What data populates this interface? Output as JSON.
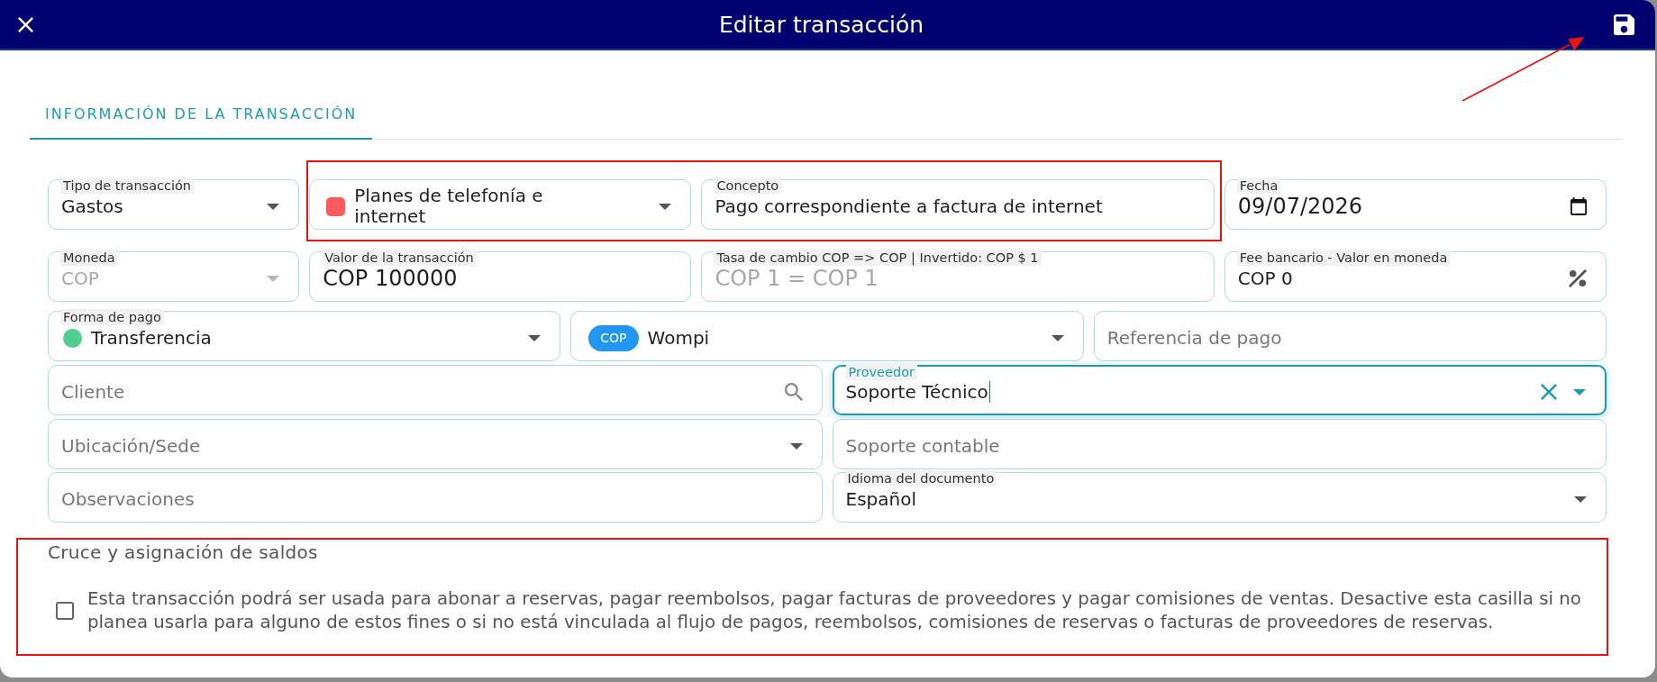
{
  "dialog": {
    "title": "Editar transacción"
  },
  "tabs": [
    {
      "label": "INFORMACIÓN DE LA TRANSACCIÓN",
      "selected": true
    }
  ],
  "form": {
    "rows": [
      [
        {
          "kind": "select",
          "label": "Tipo de transacción",
          "value": "Gastos",
          "disabled": false,
          "focused": false
        },
        {
          "kind": "select",
          "value": "Planes de telefonía e internet",
          "swatch": {
            "kind": "square",
            "color": "#ff5a5f"
          },
          "disabled": false,
          "focused": false
        },
        {
          "kind": "text",
          "label": "Concepto",
          "value": "Pago correspondiente a factura de internet",
          "disabled": false,
          "focused": false
        },
        {
          "kind": "date",
          "label": "Fecha",
          "value": "09/07/2026",
          "disabled": false,
          "focused": false
        }
      ],
      [
        {
          "kind": "select",
          "label": "Moneda",
          "value": "COP",
          "disabled": true,
          "focused": false
        },
        {
          "kind": "amount",
          "label": "Valor de la transacción",
          "value": "COP 100000",
          "disabled": false,
          "focused": false
        },
        {
          "kind": "amount",
          "label": "Tasa de cambio COP => COP | Invertido: COP $ 1",
          "value": "COP 1 = COP 1",
          "disabled": true,
          "focused": false
        },
        {
          "kind": "percent",
          "label": "Fee bancario - Valor en moneda",
          "value": "COP 0",
          "disabled": false,
          "focused": false
        }
      ],
      [
        {
          "kind": "select",
          "label": "Forma de pago",
          "value": "Transferencia",
          "swatch": {
            "kind": "dot",
            "color": "#4fcf8d"
          },
          "disabled": false,
          "focused": false
        },
        {
          "kind": "select",
          "chip": "COP",
          "value": "Wompi",
          "disabled": false,
          "focused": false
        },
        {
          "kind": "text",
          "placeholder": "Referencia de pago",
          "disabled": false,
          "focused": false
        }
      ],
      [
        {
          "kind": "search",
          "placeholder": "Cliente",
          "disabled": false,
          "focused": false
        },
        {
          "kind": "autocomplete",
          "label": "Proveedor",
          "value": "Soporte Técnico",
          "disabled": false,
          "focused": true
        }
      ],
      [
        {
          "kind": "select",
          "placeholder": "Ubicación/Sede",
          "disabled": false,
          "focused": false
        },
        {
          "kind": "text",
          "placeholder": "Soporte contable",
          "disabled": false,
          "focused": false
        }
      ],
      [
        {
          "kind": "text",
          "placeholder": "Observaciones",
          "disabled": false,
          "focused": false
        },
        {
          "kind": "select",
          "label": "Idioma del documento",
          "value": "Español",
          "disabled": false,
          "focused": false
        }
      ]
    ]
  },
  "balances": {
    "title": "Cruce y asignación de saldos",
    "checkbox": {
      "checked": false,
      "label": "Esta transacción podrá ser usada para abonar a reservas, pagar reembolsos, pagar facturas de proveedores y pagar comisiones de ventas. Desactive esta casilla si no planea usarla para alguno de estos fines o si no está vinculada al flujo de pagos, reembolsos, comisiones de reservas o facturas de proveedores de reservas."
    }
  }
}
